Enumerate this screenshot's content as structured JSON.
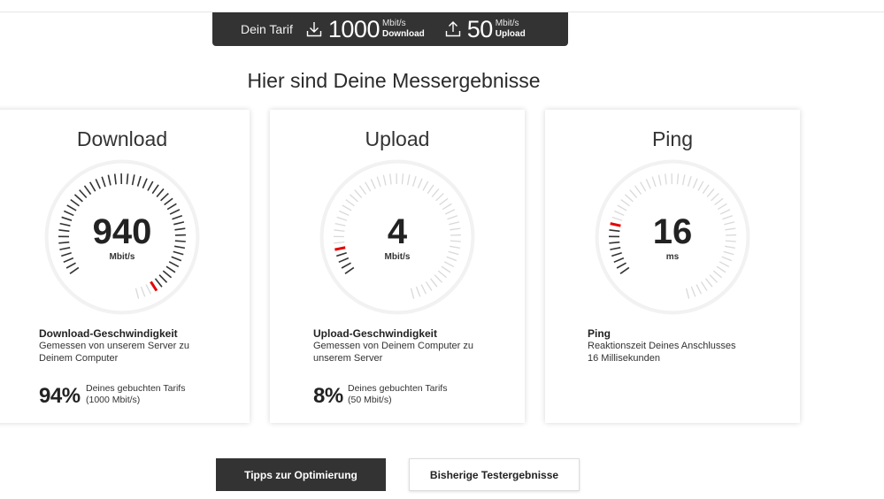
{
  "tarif": {
    "label": "Dein Tarif",
    "download": {
      "value": "1000",
      "unit": "Mbit/s",
      "label": "Download",
      "icon": "download-icon"
    },
    "upload": {
      "value": "50",
      "unit": "Mbit/s",
      "label": "Upload",
      "icon": "upload-icon"
    }
  },
  "headline": "Hier sind Deine Messergebnisse",
  "cards": [
    {
      "title": "Download",
      "value": "940",
      "unit": "Mbit/s",
      "gauge_level": 0.94,
      "metric_title": "Download-Geschwindigkeit",
      "metric_desc": "Gemessen von unserem Server zu Deinem Computer",
      "percent": "94%",
      "percent_desc_1": "Deines gebuchten Tarifs",
      "percent_desc_2": "(1000 Mbit/s)"
    },
    {
      "title": "Upload",
      "value": "4",
      "unit": "Mbit/s",
      "gauge_level": 0.08,
      "metric_title": "Upload-Geschwindigkeit",
      "metric_desc": "Gemessen von Deinem Computer zu unserem Server",
      "percent": "8%",
      "percent_desc_1": "Deines gebuchten Tarifs",
      "percent_desc_2": "(50 Mbit/s)"
    },
    {
      "title": "Ping",
      "value": "16",
      "unit": "ms",
      "gauge_level": 0.16,
      "metric_title": "Ping",
      "metric_desc": "Reaktionszeit Deines Anschlusses",
      "metric_desc_2": "16 Millisekunden"
    }
  ],
  "buttons": {
    "tips": "Tipps zur Optimierung",
    "history": "Bisherige Testergebnisse"
  },
  "colors": {
    "accent": "#e60000",
    "dark": "#333333",
    "tick_inactive": "#d9d9d9",
    "tick_active": "#333333"
  }
}
